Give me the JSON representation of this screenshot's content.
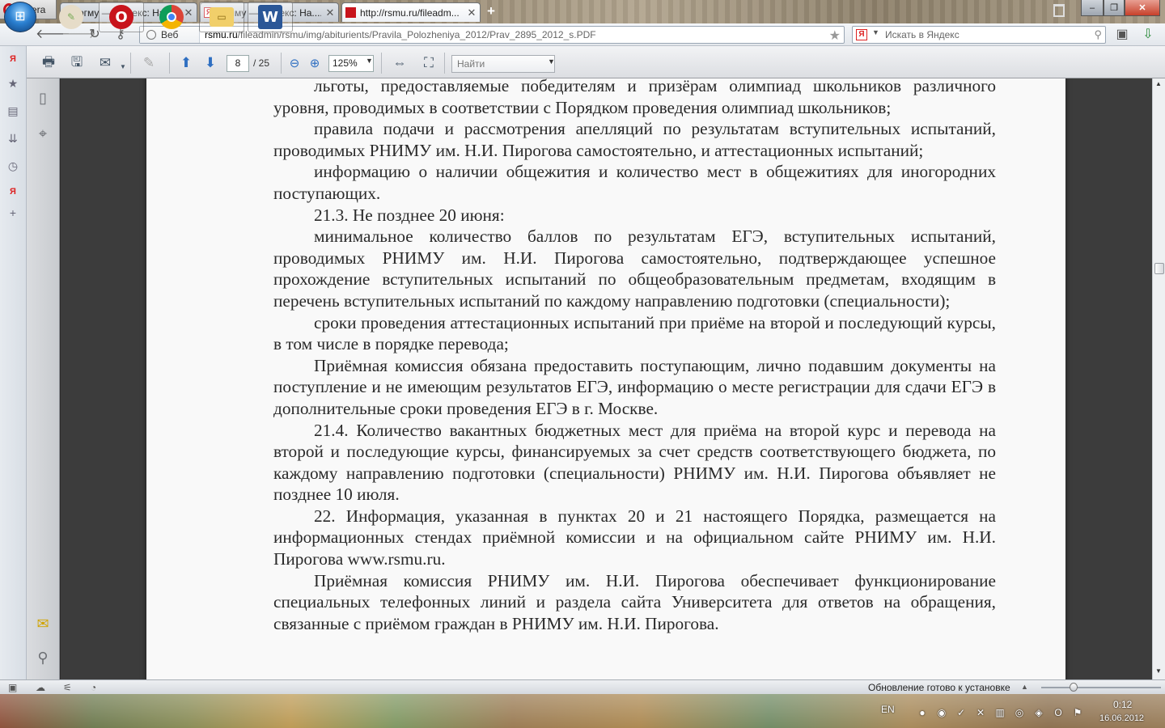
{
  "browser": {
    "menu_label": "Opera",
    "tabs": [
      {
        "title": "ргму — Яндекс: Нашл...",
        "favicon": "Я"
      },
      {
        "title": "рниму — Яндекс: На....",
        "favicon": "Я"
      },
      {
        "title": "http://rsmu.ru/fileadm...",
        "favicon": "PDF"
      }
    ],
    "address": {
      "mode_label": "Веб",
      "domain": "rsmu.ru",
      "path": "/fileadmin/rsmu/img/abiturients/Pravila_Polozheniya_2012/Prav_2895_2012_s.PDF"
    },
    "search": {
      "engine_icon": "Я",
      "placeholder": "Искать в Яндекс"
    }
  },
  "pdf_toolbar": {
    "current_page": "8",
    "total_pages": "/ 25",
    "zoom": "125%",
    "find_placeholder": "Найти"
  },
  "document": {
    "paragraphs": [
      "льготы, предоставляемые победителям и призёрам олимпиад школьников различного уровня, проводимых в соответствии с Порядком проведения олимпиад школьников;",
      "правила подачи и рассмотрения апелляций по результатам вступительных испытаний, проводимых РНИМУ им. Н.И. Пирогова самостоятельно, и аттестационных испытаний;",
      "информацию о наличии общежития и количество мест в общежитиях для иногородних поступающих.",
      "21.3. Не позднее 20 июня:",
      "минимальное количество баллов по результатам ЕГЭ, вступительных испытаний, проводимых РНИМУ им. Н.И. Пирогова самостоятельно, подтверждающее успешное прохождение вступительных испытаний по общеобразовательным предметам, входящим в перечень вступительных испытаний по каждому направлению подготовки (специальности);",
      "сроки проведения аттестационных испытаний при приёме на второй и последующий курсы, в том числе в порядке перевода;",
      "Приёмная комиссия обязана предоставить поступающим, лично подавшим документы на поступление и не имеющим результатов ЕГЭ, информацию о месте регистрации для сдачи ЕГЭ в дополнительные сроки проведения ЕГЭ в г. Москве.",
      "21.4. Количество вакантных бюджетных мест для приёма на второй курс и перевода на второй и последующие курсы, финансируемых за счет средств соответствующего бюджета, по каждому направлению подготовки (специальности) РНИМУ им. Н.И. Пирогова объявляет не позднее 10 июля.",
      "22. Информация, указанная в пунктах 20 и 21 настоящего Порядка, размещается на информационных стендах приёмной комиссии и на официальном сайте РНИМУ им. Н.И. Пирогова www.rsmu.ru.",
      "Приёмная комиссия РНИМУ им. Н.И. Пирогова обеспечивает функционирование специальных телефонных линий и раздела сайта Университета для ответов на обращения, связанные с приёмом граждан в РНИМУ им. Н.И. Пирогова."
    ]
  },
  "statusbar": {
    "update_text": "Обновление готово к установке"
  },
  "taskbar": {
    "apps": [
      "opera",
      "chrome",
      "explorer",
      "word"
    ],
    "language": "EN",
    "time": "0:12",
    "date": "16.06.2012"
  },
  "colors": {
    "opera_red": "#c8141c",
    "page_bg": "#f9f9f9",
    "viewer_bg": "#3c3c3c"
  }
}
